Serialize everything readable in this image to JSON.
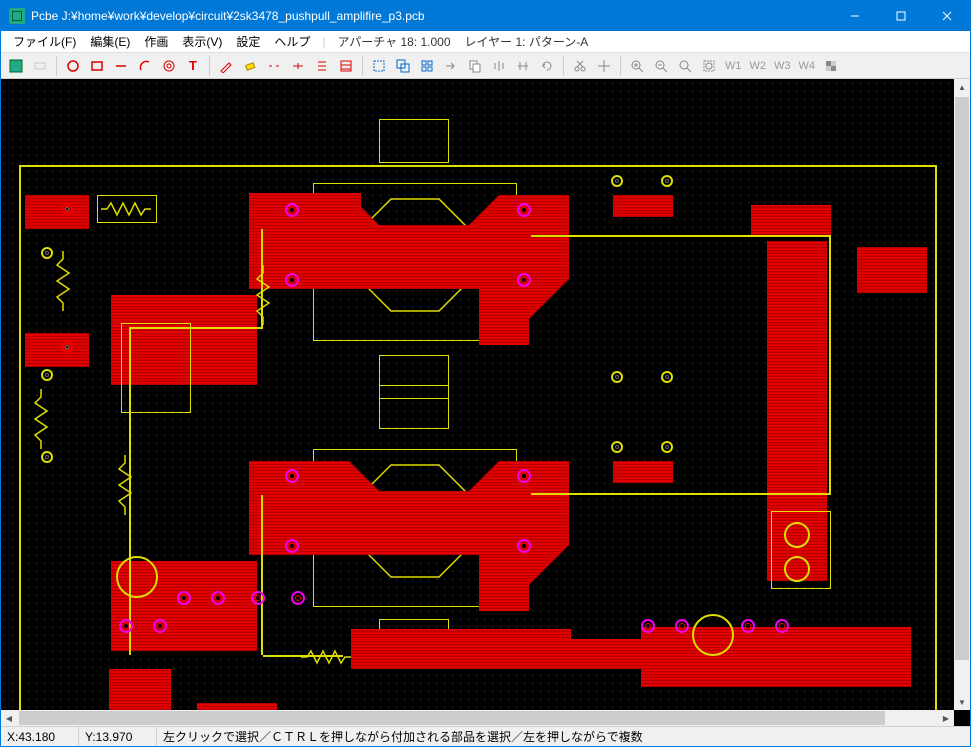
{
  "window": {
    "title": "Pcbe J:¥home¥work¥develop¥circuit¥2sk3478_pushpull_amplifire_p3.pcb"
  },
  "menubar": {
    "file": "ファイル(F)",
    "edit": "編集(E)",
    "draw": "作画",
    "view": "表示(V)",
    "settings": "設定",
    "help": "ヘルプ",
    "aperture": "アパーチャ 18: 1.000",
    "layer": "レイヤー 1: パターン-A"
  },
  "toolbar": {
    "w1": "W1",
    "w2": "W2",
    "w3": "W3",
    "w4": "W4"
  },
  "statusbar": {
    "x": "X:43.180",
    "y": "Y:13.970",
    "hint": "左クリックで選択／ＣＴＲＬを押しながら付加される部品を選択／左を押しながらで複数"
  },
  "canvas": {
    "colors": {
      "copper": "#e00000",
      "silk": "#dede00",
      "pad_magenta": "#e000e0",
      "board": "#000000"
    }
  }
}
